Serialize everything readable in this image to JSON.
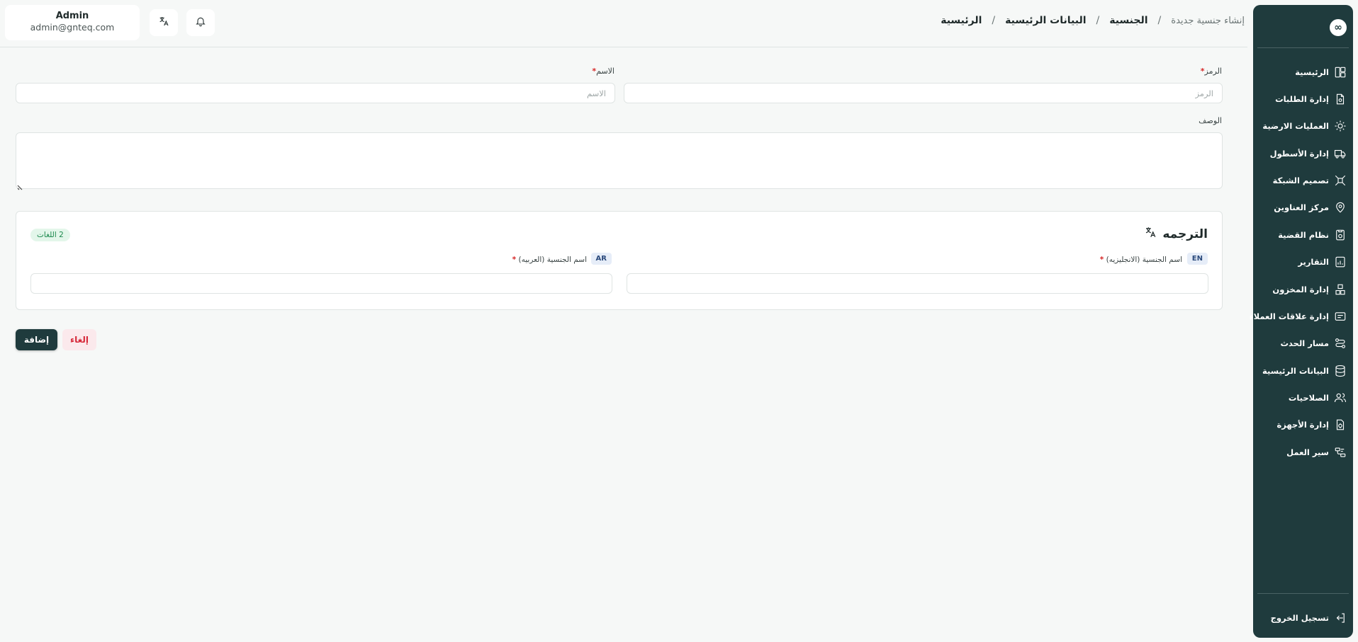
{
  "sidebar": {
    "logo": "∞",
    "items": [
      {
        "label": "الرئيسية",
        "icon": "layout-dashboard-icon"
      },
      {
        "label": "إدارة الطلبات",
        "icon": "file-settings-icon"
      },
      {
        "label": "العمليات الارضية",
        "icon": "sun-gear-icon"
      },
      {
        "label": "إدارة الأسطول",
        "icon": "truck-icon"
      },
      {
        "label": "تصميم الشبكة",
        "icon": "network-icon"
      },
      {
        "label": "مركز العناوين",
        "icon": "map-pin-icon"
      },
      {
        "label": "نظام القضية",
        "icon": "case-file-icon"
      },
      {
        "label": "التقارير",
        "icon": "report-chart-icon"
      },
      {
        "label": "إدارة المخزون",
        "icon": "warehouse-icon"
      },
      {
        "label": "إدارة علاقات العملاء",
        "icon": "crm-card-icon"
      },
      {
        "label": "مسار الحدث",
        "icon": "route-icon"
      },
      {
        "label": "البيانات الرئيسية",
        "icon": "database-icon"
      },
      {
        "label": "الصلاحيات",
        "icon": "users-icon"
      },
      {
        "label": "إدارة الأجهزة",
        "icon": "device-settings-icon"
      },
      {
        "label": "سير العمل",
        "icon": "workflow-icon"
      }
    ],
    "logout_label": "تسجيل الخروج"
  },
  "header": {
    "breadcrumb": [
      "الرئيسية",
      "البيانات الرئيسية",
      "الجنسية",
      "إنشاء جنسية جديدة"
    ],
    "separator": "/",
    "user_name": "Admin",
    "user_email": "admin@gnteq.com"
  },
  "form": {
    "code_label": "الرمز",
    "code_placeholder": "الرمز",
    "name_label": "الاسم",
    "name_placeholder": "الاسم",
    "description_label": "الوصف",
    "required_mark": "*"
  },
  "translation": {
    "title": "الترجمه",
    "languages_count": "2 اللغات",
    "fields": [
      {
        "badge": "EN",
        "label": "اسم الجنسية (الانجليزيه)",
        "value": ""
      },
      {
        "badge": "AR",
        "label": "اسم الجنسية (العربيه)",
        "value": ""
      }
    ]
  },
  "actions": {
    "add_label": "إضافة",
    "cancel_label": "إلغاء"
  },
  "colors": {
    "sidebar": "#1f3b3d",
    "primary_button": "#1f3b3d",
    "cancel_text": "#d62839",
    "required": "#d62828",
    "badge_green": "#1d8a4e"
  }
}
